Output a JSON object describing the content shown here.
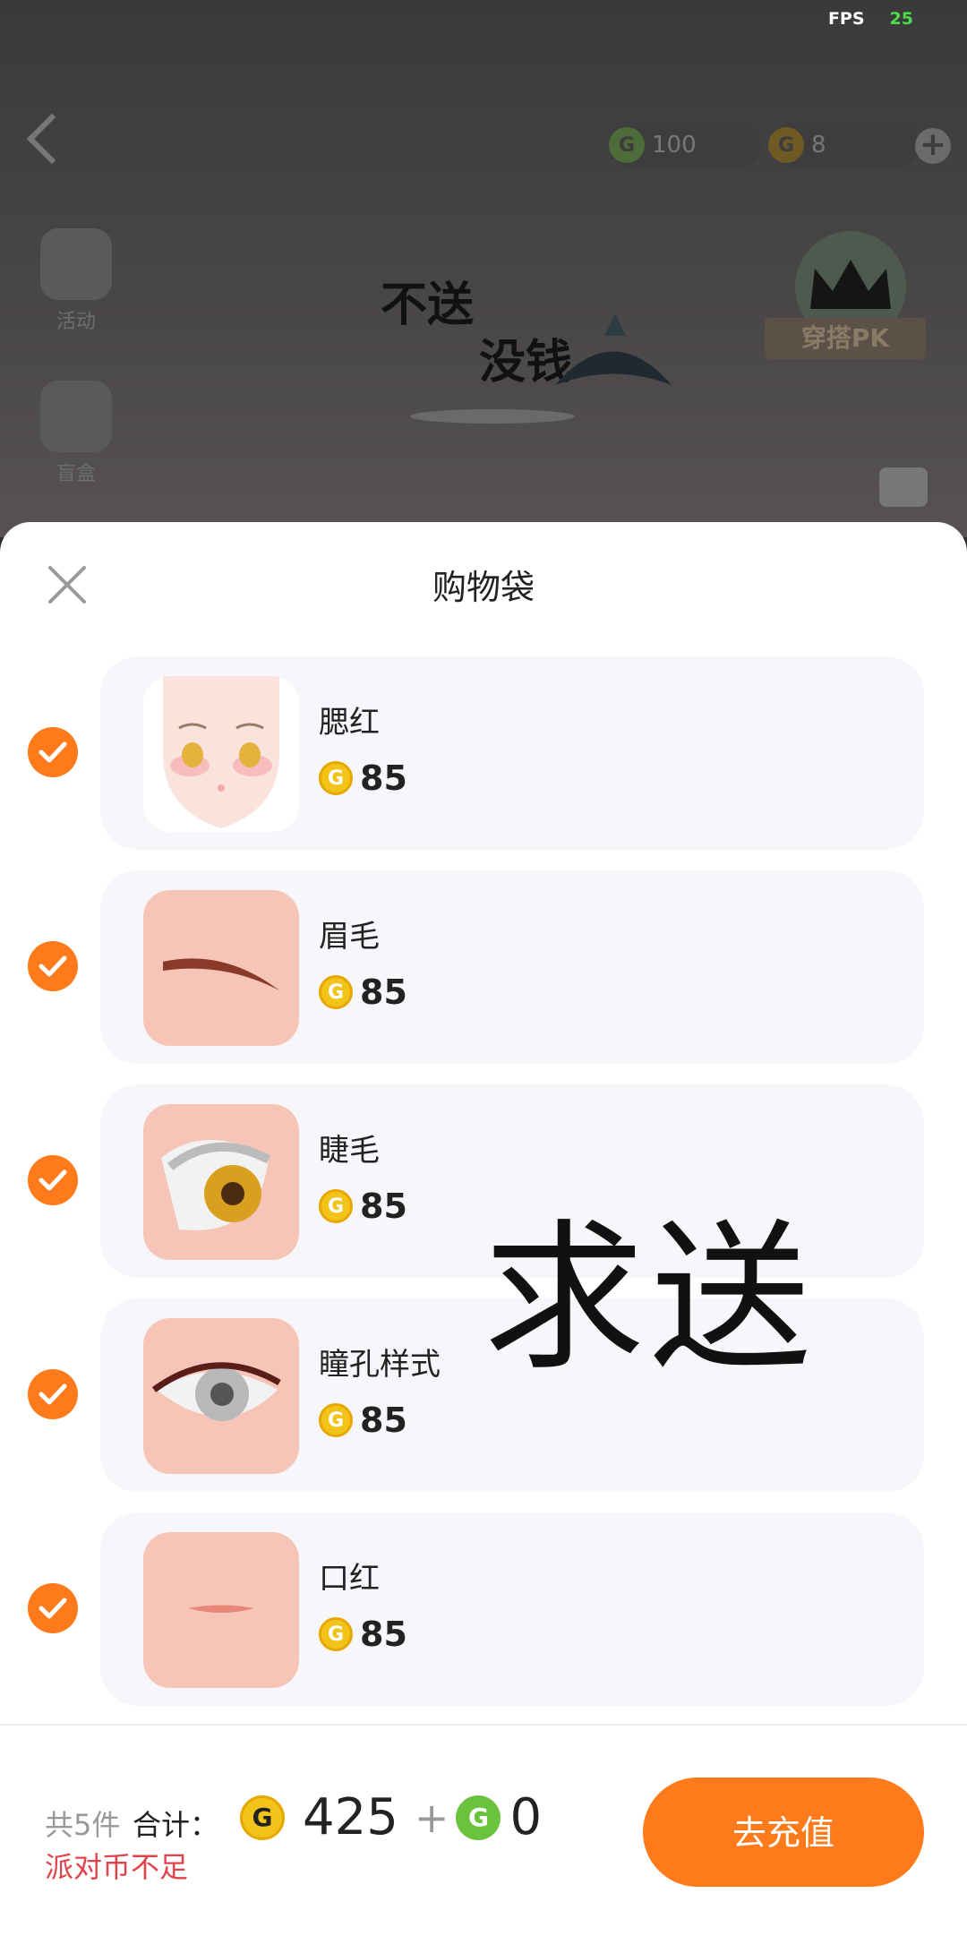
{
  "status": {
    "fps_label": "FPS",
    "fps_value": "25"
  },
  "topbar": {
    "green_coin_amount": "100",
    "gold_coin_amount": "8",
    "green_coin_color": "#6bc23d",
    "gold_coin_color": "#f2c318"
  },
  "sidebar": {
    "activity_label": "活动",
    "blindbox_label": "盲盒"
  },
  "scene": {
    "line1": "不送",
    "line2": "没钱",
    "pk_label": "穿搭PK"
  },
  "sheet": {
    "title": "购物袋",
    "items": [
      {
        "name": "腮红",
        "price": "85",
        "checked": true
      },
      {
        "name": "眉毛",
        "price": "85",
        "checked": true
      },
      {
        "name": "睫毛",
        "price": "85",
        "checked": true
      },
      {
        "name": "瞳孔样式",
        "price": "85",
        "checked": true
      },
      {
        "name": "口红",
        "price": "85",
        "checked": true
      }
    ],
    "overlay_text": "求送"
  },
  "footer": {
    "count_text": "共5件",
    "total_label": "合计：",
    "gold_total": "425",
    "plus": "+",
    "green_total": "0",
    "warning": "派对币不足",
    "recharge_label": "去充值"
  },
  "colors": {
    "accent": "#ff7a1a",
    "warning": "#e0444a"
  }
}
